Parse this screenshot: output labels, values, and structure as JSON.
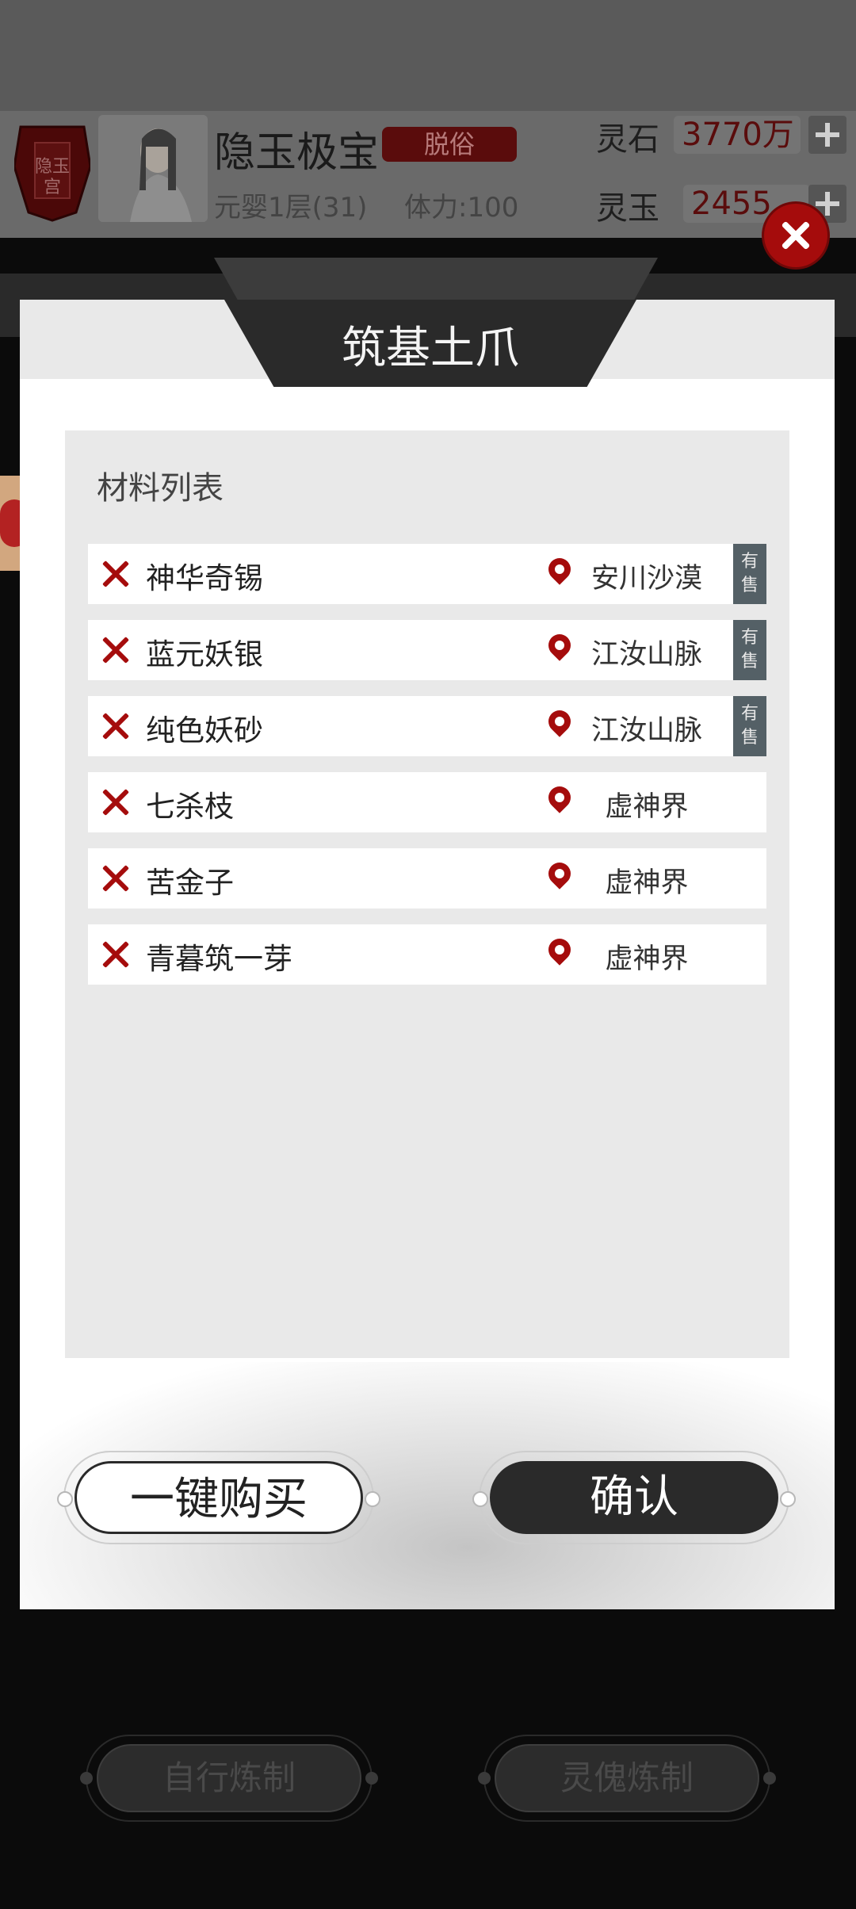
{
  "header": {
    "sect_badge": "隐玉宫",
    "player_name": "隐玉极宝",
    "title_tag": "脱俗",
    "realm": "元婴1层(31)",
    "stamina": "体力:100",
    "currencies": [
      {
        "label": "灵石",
        "value": "3770万"
      },
      {
        "label": "灵玉",
        "value": "2455"
      }
    ]
  },
  "modal": {
    "title": "筑基土爪",
    "list_heading": "材料列表",
    "materials": [
      {
        "name": "神华奇锡",
        "location": "安川沙漠",
        "badge": "有售"
      },
      {
        "name": "蓝元妖银",
        "location": "江汝山脉",
        "badge": "有售"
      },
      {
        "name": "纯色妖砂",
        "location": "江汝山脉",
        "badge": "有售"
      },
      {
        "name": "七杀枝",
        "location": "虚神界",
        "badge": ""
      },
      {
        "name": "苦金子",
        "location": "虚神界",
        "badge": ""
      },
      {
        "name": "青暮筑一芽",
        "location": "虚神界",
        "badge": ""
      }
    ],
    "buy_all_label": "一键购买",
    "confirm_label": "确认"
  },
  "bottom": {
    "self_craft_label": "自行炼制",
    "puppet_craft_label": "灵傀炼制"
  },
  "colors": {
    "accent_red": "#a50c0c",
    "dark_button": "#2a2a2a",
    "sale_badge": "#546066"
  }
}
